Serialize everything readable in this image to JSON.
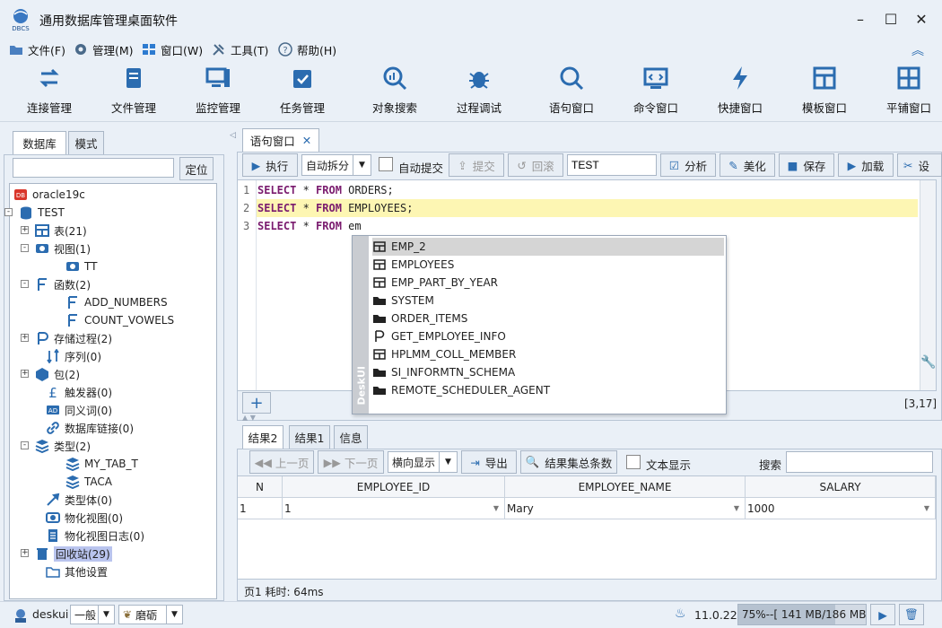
{
  "app": {
    "title": "通用数据库管理桌面软件",
    "logo_text": "DBCS"
  },
  "menu": [
    "文件(F)",
    "管理(M)",
    "窗口(W)",
    "工具(T)",
    "帮助(H)"
  ],
  "toolbar": [
    "连接管理",
    "文件管理",
    "监控管理",
    "任务管理",
    "对象搜索",
    "过程调试",
    "语句窗口",
    "命令窗口",
    "快捷窗口",
    "模板窗口",
    "平铺窗口"
  ],
  "left": {
    "tabs": [
      "数据库",
      "模式"
    ],
    "search_value": "",
    "locate_button": "定位"
  },
  "tree": [
    {
      "label": "oracle19c"
    },
    {
      "label": "TEST"
    },
    {
      "label": "表(21)"
    },
    {
      "label": "视图(1)"
    },
    {
      "label": "TT"
    },
    {
      "label": "函数(2)"
    },
    {
      "label": "ADD_NUMBERS"
    },
    {
      "label": "COUNT_VOWELS"
    },
    {
      "label": "存储过程(2)"
    },
    {
      "label": "序列(0)"
    },
    {
      "label": "包(2)"
    },
    {
      "label": "触发器(0)"
    },
    {
      "label": "同义词(0)"
    },
    {
      "label": "数据库链接(0)"
    },
    {
      "label": "类型(2)"
    },
    {
      "label": "MY_TAB_T"
    },
    {
      "label": "TACA"
    },
    {
      "label": "类型体(0)"
    },
    {
      "label": "物化视图(0)"
    },
    {
      "label": "物化视图日志(0)"
    },
    {
      "label": "回收站(29)"
    },
    {
      "label": "其他设置"
    }
  ],
  "editor": {
    "tab": "语句窗口",
    "exec": "执行",
    "split": "自动拆分",
    "autocommit": "自动提交",
    "commit": "提交",
    "rollback": "回滚",
    "schema": "TEST",
    "analyze": "分析",
    "beautify": "美化",
    "save": "保存",
    "load": "加载",
    "settings": "设",
    "lines": [
      {
        "n": "1",
        "pre": "SELECT",
        "mid": " * ",
        "kw2": "FROM",
        "post": " ORDERS;"
      },
      {
        "n": "2",
        "pre": "SELECT",
        "mid": " * ",
        "kw2": "FROM",
        "post": " EMPLOYEES;"
      },
      {
        "n": "3",
        "pre": "SELECT",
        "mid": " * ",
        "kw2": "FROM",
        "post": " em"
      }
    ],
    "cursor": "[3,17]",
    "autocomplete_brand": "DeskUI",
    "autocomplete": [
      "EMP_2",
      "EMPLOYEES",
      "EMP_PART_BY_YEAR",
      "SYSTEM",
      "ORDER_ITEMS",
      "GET_EMPLOYEE_INFO",
      "HPLMM_COLL_MEMBER",
      "SI_INFORMTN_SCHEMA",
      "REMOTE_SCHEDULER_AGENT"
    ],
    "add": "+"
  },
  "results": {
    "tabs": [
      "结果2",
      "结果1",
      "信息"
    ],
    "prev": "上一页",
    "next": "下一页",
    "display": "横向显示",
    "export": "导出",
    "count": "结果集总条数",
    "text_display": "文本显示",
    "search_label": "搜索",
    "search_value": "",
    "columns": [
      "N",
      "EMPLOYEE_ID",
      "EMPLOYEE_NAME",
      "SALARY"
    ],
    "rows": [
      [
        "1",
        "1",
        "Mary",
        "1000"
      ]
    ],
    "footer": "页1 耗时: 64ms"
  },
  "status": {
    "user": "deskui",
    "level": "一般",
    "theme": "磨砺",
    "version": "11.0.22",
    "memory": "75%--[ 141 MB/186 MB ]"
  },
  "colors": {
    "accent": "#2b6cb0",
    "keyword": "#7a1b6e",
    "highlight": "#fdf6b3",
    "bg": "#eaf0f7"
  }
}
